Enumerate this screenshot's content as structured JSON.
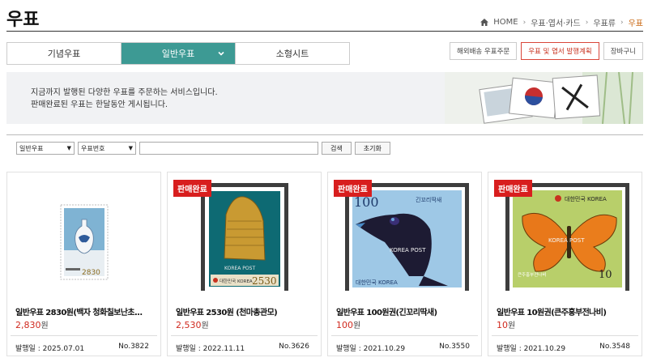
{
  "header": {
    "title": "우표",
    "breadcrumb": [
      "HOME",
      "우표·엽서·카드",
      "우표류",
      "우표"
    ]
  },
  "tabs": [
    {
      "label": "기념우표",
      "active": false
    },
    {
      "label": "일반우표",
      "active": true
    },
    {
      "label": "소형시트",
      "active": false
    }
  ],
  "right_buttons": [
    "해외배송 우표주문",
    "우표 및 엽서 발행계획",
    "장바구니"
  ],
  "banner": {
    "line1": "지금까지 발행된 다양한 우표를 주문하는 서비스입니다.",
    "line2": "판매완료된 우표는 한달동안 게시됩니다."
  },
  "filters": {
    "category": "일반우표",
    "field": "우표번호",
    "search_value": "",
    "search_label": "검색",
    "reset_label": "초기화"
  },
  "colors": {
    "accent_teal": "#3d9a94",
    "sold_out_red": "#d81e1e",
    "price_red": "#d0291e"
  },
  "products": [
    {
      "name": "일반우표 2830원(백자 청화칠보난초...",
      "price": "2,830",
      "won": "원",
      "date_label": "발행일 : 2025.07.01",
      "no": "No.3822",
      "sold_out": "",
      "stamp_denom": "2830"
    },
    {
      "name": "일반우표 2530원 (천마총관모)",
      "price": "2,530",
      "won": "원",
      "date_label": "발행일 : 2022.11.11",
      "no": "No.3626",
      "sold_out": "판매완료",
      "stamp_denom": "2530",
      "stamp_post": "KOREA POST",
      "stamp_country": "대한민국 KOREA"
    },
    {
      "name": "일반우표 100원권(긴꼬리딱새)",
      "price": "100",
      "won": "원",
      "date_label": "발행일 : 2021.10.29",
      "no": "No.3550",
      "sold_out": "판매완료",
      "stamp_denom": "100",
      "stamp_species": "긴꼬리딱새",
      "stamp_post": "KOREA POST",
      "stamp_country": "대한민국 KOREA"
    },
    {
      "name": "일반우표 10원권(큰주홍부전나비)",
      "price": "10",
      "won": "원",
      "date_label": "발행일 : 2021.10.29",
      "no": "No.3548",
      "sold_out": "판매완료",
      "stamp_denom": "10",
      "stamp_post": "KOREA POST",
      "stamp_country": "대한민국 KOREA",
      "stamp_species": "큰주홍부전나비"
    }
  ]
}
